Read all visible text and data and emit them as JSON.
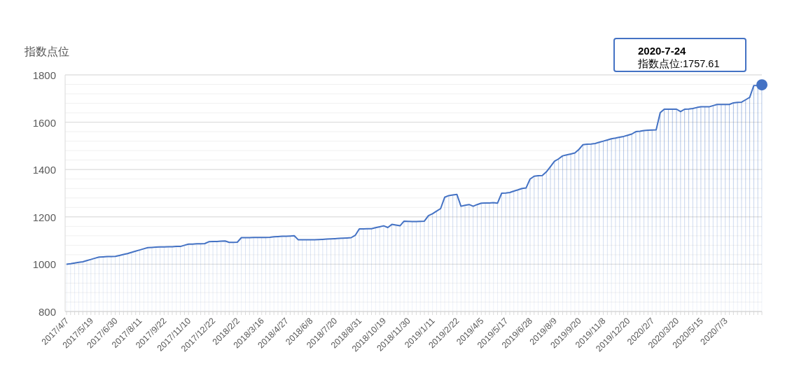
{
  "chart": {
    "chart_data": {
      "type": "area",
      "grid": true,
      "ylabel": "指数点位",
      "ylim": [
        800,
        1800
      ],
      "yticks": [
        800,
        1000,
        1200,
        1400,
        1600,
        1800
      ],
      "categories": [
        "2017/4/7",
        null,
        null,
        null,
        null,
        null,
        "2017/5/19",
        null,
        null,
        null,
        null,
        null,
        "2017/6/30",
        null,
        null,
        null,
        null,
        null,
        "2017/8/11",
        null,
        null,
        null,
        null,
        null,
        "2017/9/22",
        null,
        null,
        null,
        null,
        null,
        "2017/11/10",
        null,
        null,
        null,
        null,
        null,
        "2017/12/22",
        null,
        null,
        null,
        null,
        null,
        "2018/2/2",
        null,
        null,
        null,
        null,
        null,
        "2018/3/16",
        null,
        null,
        null,
        null,
        null,
        "2018/4/27",
        null,
        null,
        null,
        null,
        null,
        "2018/6/8",
        null,
        null,
        null,
        null,
        null,
        "2018/7/20",
        null,
        null,
        null,
        null,
        null,
        "2018/8/31",
        null,
        null,
        null,
        null,
        null,
        "2018/10/19",
        null,
        null,
        null,
        null,
        null,
        "2018/11/30",
        null,
        null,
        null,
        null,
        null,
        "2019/1/11",
        null,
        null,
        null,
        null,
        null,
        "2019/2/22",
        null,
        null,
        null,
        null,
        null,
        "2019/4/5",
        null,
        null,
        null,
        null,
        null,
        "2019/5/17",
        null,
        null,
        null,
        null,
        null,
        "2019/6/28",
        null,
        null,
        null,
        null,
        null,
        "2019/8/9",
        null,
        null,
        null,
        null,
        null,
        "2019/9/20",
        null,
        null,
        null,
        null,
        null,
        "2019/11/8",
        null,
        null,
        null,
        null,
        null,
        "2019/12/20",
        null,
        null,
        null,
        null,
        null,
        "2020/2/7",
        null,
        null,
        null,
        null,
        null,
        "2020/3/20",
        null,
        null,
        null,
        null,
        null,
        "2020/5/15",
        null,
        null,
        null,
        null,
        null,
        "2020/7/3",
        null,
        null,
        null,
        null,
        null,
        null,
        null,
        null,
        null
      ],
      "series": [
        {
          "color": "#4472c4",
          "values": [
            1000,
            1002,
            1005,
            1008,
            1010,
            1015,
            1020,
            1025,
            1030,
            1031,
            1032,
            1032,
            1033,
            1037,
            1041,
            1045,
            1050,
            1055,
            1060,
            1065,
            1070,
            1071,
            1072,
            1073,
            1073,
            1074,
            1074,
            1075,
            1075,
            1080,
            1085,
            1085,
            1086,
            1086,
            1087,
            1095,
            1096,
            1096,
            1097,
            1098,
            1092,
            1092,
            1093,
            1112,
            1112,
            1112,
            1113,
            1113,
            1113,
            1113,
            1114,
            1116,
            1117,
            1118,
            1118,
            1119,
            1120,
            1103,
            1103,
            1103,
            1103,
            1103,
            1104,
            1105,
            1106,
            1107,
            1108,
            1109,
            1110,
            1111,
            1112,
            1122,
            1149,
            1149,
            1150,
            1150,
            1154,
            1158,
            1162,
            1155,
            1168,
            1165,
            1162,
            1182,
            1181,
            1180,
            1180,
            1181,
            1182,
            1205,
            1213,
            1224,
            1235,
            1283,
            1290,
            1293,
            1295,
            1245,
            1249,
            1252,
            1245,
            1252,
            1258,
            1259,
            1259,
            1260,
            1258,
            1300,
            1301,
            1303,
            1309,
            1314,
            1320,
            1322,
            1360,
            1372,
            1374,
            1375,
            1390,
            1412,
            1435,
            1445,
            1458,
            1462,
            1466,
            1470,
            1485,
            1505,
            1507,
            1508,
            1510,
            1515,
            1520,
            1525,
            1530,
            1533,
            1537,
            1540,
            1545,
            1550,
            1560,
            1562,
            1565,
            1566,
            1567,
            1568,
            1640,
            1655,
            1655,
            1655,
            1655,
            1645,
            1655,
            1656,
            1658,
            1662,
            1665,
            1665,
            1665,
            1670,
            1675,
            1675,
            1675,
            1675,
            1682,
            1684,
            1685,
            1695,
            1705,
            1755,
            1756,
            1758
          ]
        }
      ]
    },
    "tooltip": {
      "title": "2020-7-24",
      "text": "指数点位:1757.61"
    }
  }
}
